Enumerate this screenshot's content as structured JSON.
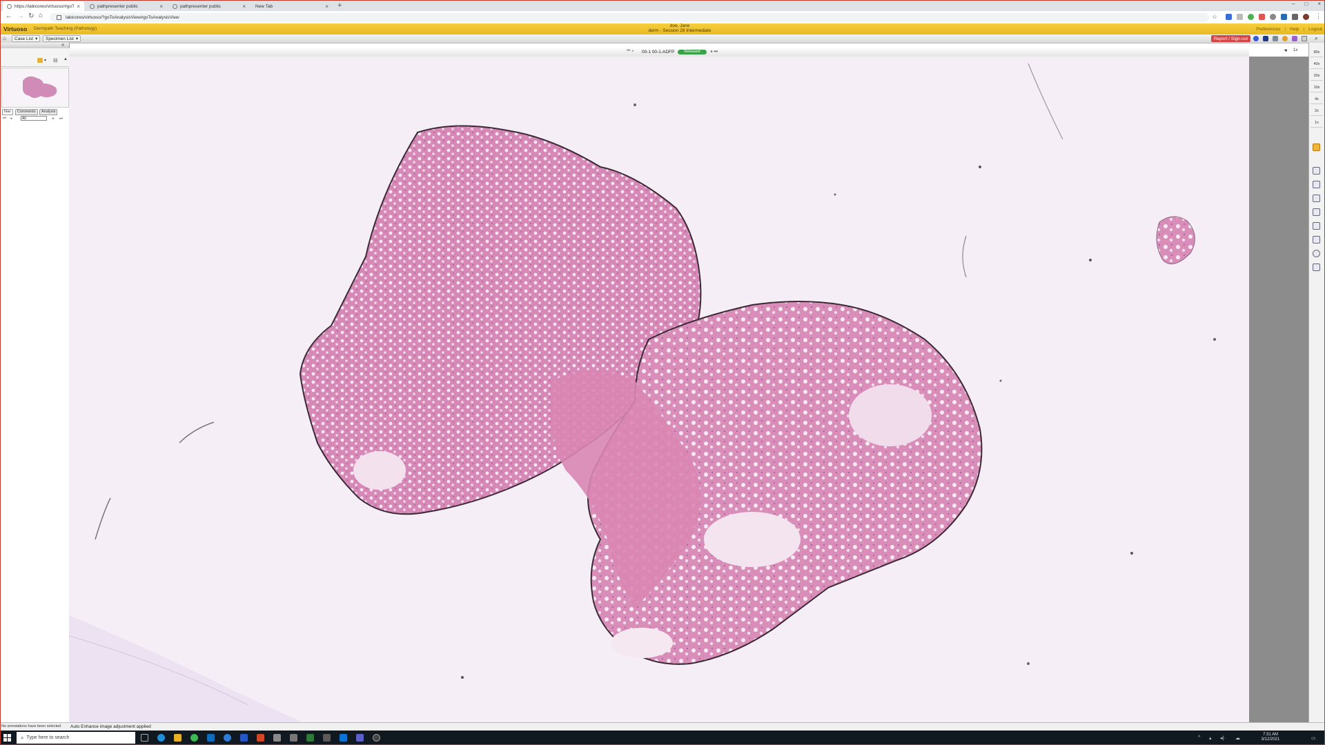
{
  "browser": {
    "tabs": [
      {
        "title": "https://labicoreo/virtuoso/#goTo",
        "active": true
      },
      {
        "title": "pathpresenter public",
        "active": false
      },
      {
        "title": "pathpresenter public",
        "active": false
      },
      {
        "title": "New Tab",
        "active": false
      }
    ],
    "new_tab": "+",
    "url": "labicoreo/virtuoso/?goToAnalysisView#goToAnalysisView"
  },
  "app": {
    "brand": "Virtuoso",
    "sub": "Dermpath  Teaching (Pathology)",
    "user_name": "doe, Jane",
    "session": "derm - Session 28 Intermediate",
    "links": [
      "Preferences",
      "Help",
      "Logout"
    ]
  },
  "toolbar": {
    "case_list": "Case List",
    "specimen_list": "Specimen List",
    "report_btn": "Report / Sign-out"
  },
  "viewer": {
    "slide_id": "00-1 00-1-ADFP",
    "status": "Released",
    "zoom_levels": [
      "80x",
      "40x",
      "20x",
      "10x",
      "4x",
      "2x",
      "1x"
    ],
    "zoom_current": "1x"
  },
  "left_panel": {
    "tabs": [
      "Nav",
      "Comments",
      "Analysis"
    ],
    "filter": "All"
  },
  "status": {
    "annotations": "No annotations have been selected",
    "message": "Auto Enhance image adjustment applied"
  },
  "taskbar": {
    "search": "Type here to search",
    "time": "7:31 AM",
    "date": "3/12/2021"
  },
  "colors": {
    "app_header": "#f0c330",
    "tissue": "#d98cb8",
    "slide_bg": "#f5eef7",
    "released": "#3aa04a",
    "report": "#d64545"
  }
}
